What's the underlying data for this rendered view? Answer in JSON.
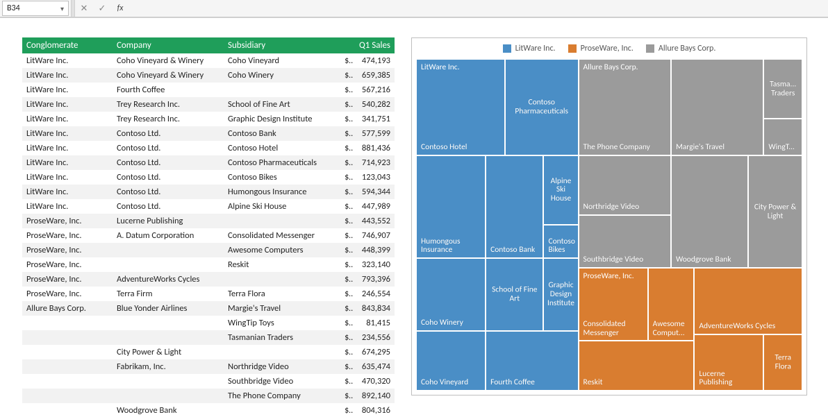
{
  "namebox": {
    "value": "B34"
  },
  "formula": {
    "value": ""
  },
  "icons": {
    "cancel": "✕",
    "enter": "✓",
    "fx": "fx",
    "chevron": "▾"
  },
  "headers": {
    "conglomerate": "Conglomerate",
    "company": "Company",
    "subsidiary": "Subsidiary",
    "q1sales": "Q1 Sales"
  },
  "currency": "$",
  "rows": [
    {
      "cong": "LitWare Inc.",
      "comp": "Coho Vineyard & Winery",
      "sub": "Coho Vineyard",
      "val": "474,193"
    },
    {
      "cong": "LitWare Inc.",
      "comp": "Coho Vineyard & Winery",
      "sub": "Coho Winery",
      "val": "659,385"
    },
    {
      "cong": "LitWare Inc.",
      "comp": "Fourth Coffee",
      "sub": "",
      "val": "567,216"
    },
    {
      "cong": "LitWare Inc.",
      "comp": "Trey Research Inc.",
      "sub": "School of Fine Art",
      "val": "540,282"
    },
    {
      "cong": "LitWare Inc.",
      "comp": "Trey Research Inc.",
      "sub": "Graphic Design Institute",
      "val": "341,751"
    },
    {
      "cong": "LitWare Inc.",
      "comp": "Contoso Ltd.",
      "sub": "Contoso Bank",
      "val": "577,599"
    },
    {
      "cong": "LitWare Inc.",
      "comp": "Contoso Ltd.",
      "sub": "Contoso Hotel",
      "val": "881,436"
    },
    {
      "cong": "LitWare Inc.",
      "comp": "Contoso Ltd.",
      "sub": "Contoso Pharmaceuticals",
      "val": "714,923"
    },
    {
      "cong": "LitWare Inc.",
      "comp": "Contoso Ltd.",
      "sub": "Contoso Bikes",
      "val": "123,043"
    },
    {
      "cong": "LitWare Inc.",
      "comp": "Contoso Ltd.",
      "sub": "Humongous Insurance",
      "val": "594,344"
    },
    {
      "cong": "LitWare Inc.",
      "comp": "Contoso Ltd.",
      "sub": "Alpine Ski House",
      "val": "447,989"
    },
    {
      "cong": "ProseWare, Inc.",
      "comp": "Lucerne Publishing",
      "sub": "",
      "val": "443,552"
    },
    {
      "cong": "ProseWare, Inc.",
      "comp": "A. Datum Corporation",
      "sub": "Consolidated Messenger",
      "val": "746,907"
    },
    {
      "cong": "ProseWare, Inc.",
      "comp": "",
      "sub": "Awesome Computers",
      "val": "448,399"
    },
    {
      "cong": "ProseWare, Inc.",
      "comp": "",
      "sub": "Reskit",
      "val": "323,140"
    },
    {
      "cong": "ProseWare, Inc.",
      "comp": "AdventureWorks Cycles",
      "sub": "",
      "val": "793,396"
    },
    {
      "cong": "ProseWare, Inc.",
      "comp": "Terra Firm",
      "sub": "Terra Flora",
      "val": "246,554"
    },
    {
      "cong": "Allure Bays Corp.",
      "comp": "Blue Yonder Airlines",
      "sub": "Margie's Travel",
      "val": "843,834"
    },
    {
      "cong": "",
      "comp": "",
      "sub": "WingTip Toys",
      "val": "81,415"
    },
    {
      "cong": "",
      "comp": "",
      "sub": "Tasmanian Traders",
      "val": "234,556"
    },
    {
      "cong": "",
      "comp": "City Power & Light",
      "sub": "",
      "val": "674,295"
    },
    {
      "cong": "",
      "comp": "Fabrikam, Inc.",
      "sub": "Northridge Video",
      "val": "635,474"
    },
    {
      "cong": "",
      "comp": "",
      "sub": "Southbridge Video",
      "val": "470,320"
    },
    {
      "cong": "",
      "comp": "",
      "sub": "The Phone Company",
      "val": "892,140"
    },
    {
      "cong": "",
      "comp": "Woodgrove Bank",
      "sub": "",
      "val": "804,316"
    }
  ],
  "chart_data": {
    "type": "treemap",
    "legend": [
      {
        "name": "LitWare Inc.",
        "color": "#4a8ec6"
      },
      {
        "name": "ProseWare, Inc.",
        "color": "#d97d30"
      },
      {
        "name": "Allure Bays Corp.",
        "color": "#9b9b9b"
      }
    ],
    "series": [
      {
        "group": "LitWare Inc.",
        "name": "Contoso Hotel",
        "value": 881436
      },
      {
        "group": "LitWare Inc.",
        "name": "Contoso Pharmaceuticals",
        "value": 714923
      },
      {
        "group": "LitWare Inc.",
        "name": "Humongous Insurance",
        "value": 594344
      },
      {
        "group": "LitWare Inc.",
        "name": "Contoso Bank",
        "value": 577599
      },
      {
        "group": "LitWare Inc.",
        "name": "Alpine Ski House",
        "value": 447989
      },
      {
        "group": "LitWare Inc.",
        "name": "Contoso Bikes",
        "value": 123043
      },
      {
        "group": "LitWare Inc.",
        "name": "Coho Winery",
        "value": 659385
      },
      {
        "group": "LitWare Inc.",
        "name": "School of Fine Art",
        "value": 540282
      },
      {
        "group": "LitWare Inc.",
        "name": "Graphic Design Institute",
        "value": 341751
      },
      {
        "group": "LitWare Inc.",
        "name": "Coho Vineyard",
        "value": 474193
      },
      {
        "group": "LitWare Inc.",
        "name": "Fourth Coffee",
        "value": 567216
      },
      {
        "group": "Allure Bays Corp.",
        "name": "The Phone Company",
        "value": 892140
      },
      {
        "group": "Allure Bays Corp.",
        "name": "Margie's Travel",
        "value": 843834
      },
      {
        "group": "Allure Bays Corp.",
        "name": "Tasmanian Traders",
        "value": 234556
      },
      {
        "group": "Allure Bays Corp.",
        "name": "WingTip Toys",
        "value": 81415
      },
      {
        "group": "Allure Bays Corp.",
        "name": "Northridge Video",
        "value": 635474
      },
      {
        "group": "Allure Bays Corp.",
        "name": "Southbridge Video",
        "value": 470320
      },
      {
        "group": "Allure Bays Corp.",
        "name": "Woodgrove Bank",
        "value": 804316
      },
      {
        "group": "Allure Bays Corp.",
        "name": "City Power & Light",
        "value": 674295
      },
      {
        "group": "ProseWare, Inc.",
        "name": "Consolidated Messenger",
        "value": 746907
      },
      {
        "group": "ProseWare, Inc.",
        "name": "Awesome Computers",
        "value": 448399
      },
      {
        "group": "ProseWare, Inc.",
        "name": "Reskit",
        "value": 323140
      },
      {
        "group": "ProseWare, Inc.",
        "name": "AdventureWorks Cycles",
        "value": 793396
      },
      {
        "group": "ProseWare, Inc.",
        "name": "Lucerne Publishing",
        "value": 443552
      },
      {
        "group": "ProseWare, Inc.",
        "name": "Terra Flora",
        "value": 246554
      }
    ]
  },
  "tiles": {
    "litware_cat": "LitWare Inc.",
    "allure_cat": "Allure Bays Corp.",
    "prose_cat": "ProseWare, Inc.",
    "contoso_hotel": "Contoso Hotel",
    "contoso_pharma": "Contoso Pharmaceuticals",
    "humongous": "Humongous Insurance",
    "contoso_bank": "Contoso Bank",
    "alpine": "Alpine Ski House",
    "contoso_bikes": "Contoso Bikes",
    "coho_winery": "Coho Winery",
    "school": "School of Fine Art",
    "gdi": "Graphic Design Institute",
    "coho_vineyard": "Coho Vineyard",
    "fourth_coffee": "Fourth Coffee",
    "phone": "The Phone Company",
    "margies": "Margie's Travel",
    "tasman": "Tasma... Traders",
    "wingtip": "WingT...",
    "northridge": "Northridge Video",
    "southbridge": "Southbridge Video",
    "woodgrove": "Woodgrove Bank",
    "citypower": "City Power & Light",
    "consolidated": "Consolidated Messenger",
    "awesome": "Awesome Comput...",
    "reskit": "Reskit",
    "adventure": "AdventureWorks Cycles",
    "lucerne": "Lucerne Publishing",
    "terra": "Terra Flora"
  }
}
